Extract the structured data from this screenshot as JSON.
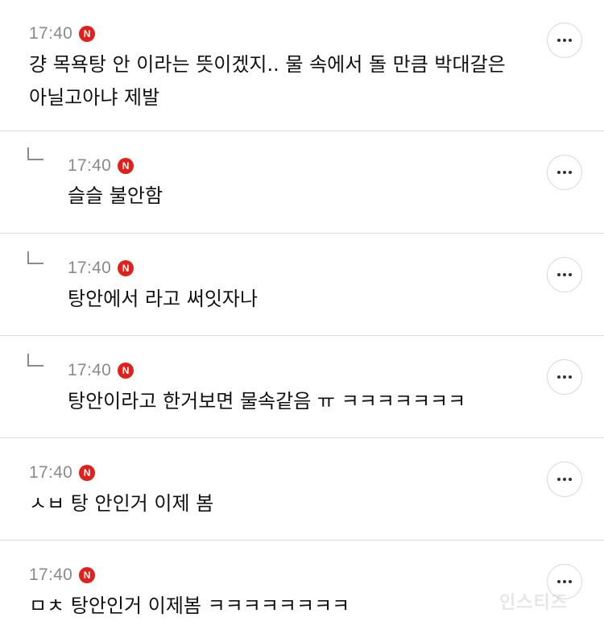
{
  "comments": [
    {
      "time": "17:40",
      "badge": "N",
      "text": "걍 목욕탕 안 이라는 뜻이겠지.. 물 속에서 돌 만큼 박대갈은\n아닐고아냐 제발",
      "is_reply": false
    },
    {
      "time": "17:40",
      "badge": "N",
      "text": "슬슬 불안함",
      "is_reply": true
    },
    {
      "time": "17:40",
      "badge": "N",
      "text": "탕안에서 라고 써잇자나",
      "is_reply": true
    },
    {
      "time": "17:40",
      "badge": "N",
      "text": "탕안이라고 한거보면 물속같음 ㅠ ㅋㅋㅋㅋㅋㅋㅋ",
      "is_reply": true
    },
    {
      "time": "17:40",
      "badge": "N",
      "text": "ㅅㅂ 탕 안인거 이제 봄",
      "is_reply": false
    },
    {
      "time": "17:40",
      "badge": "N",
      "text": "ㅁㅊ 탕안인거 이제봄 ㅋㅋㅋㅋㅋㅋㅋㅋ",
      "is_reply": false
    }
  ],
  "icons": {
    "more": "more-options-icon",
    "reply": "reply-arrow-icon",
    "new_badge": "new-badge-icon"
  },
  "colors": {
    "badge": "#e0201b",
    "time": "#8a8a8a",
    "divider": "#dcdcdc"
  },
  "watermark": "인스티즈"
}
